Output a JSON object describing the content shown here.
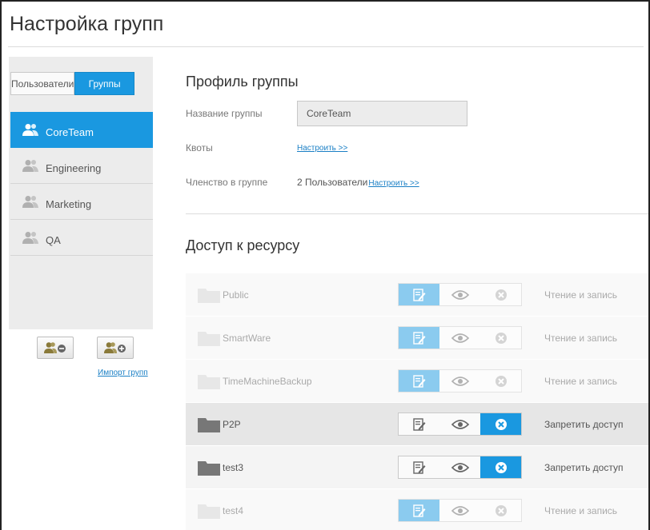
{
  "page": {
    "title": "Настройка групп"
  },
  "sidebar": {
    "tabs": {
      "users": "Пользователи",
      "groups": "Группы"
    },
    "groups": [
      {
        "name": "CoreTeam",
        "active": true
      },
      {
        "name": "Engineering",
        "active": false
      },
      {
        "name": "Marketing",
        "active": false
      },
      {
        "name": "QA",
        "active": false
      }
    ],
    "import_label": "Импорт групп"
  },
  "profile": {
    "title": "Профиль группы",
    "name_label": "Название группы",
    "name_value": "CoreTeam",
    "quota_label": "Квоты",
    "quota_link": "Настроить >>",
    "membership_label": "Членство в группе",
    "membership_count": "2 Пользователи",
    "membership_link": "Настроить >>"
  },
  "access": {
    "title": "Доступ к ресурсу",
    "shares": [
      {
        "name": "Public",
        "status": "Чтение и запись",
        "permission": "read-write",
        "enabled": false
      },
      {
        "name": "SmartWare",
        "status": "Чтение и запись",
        "permission": "read-write",
        "enabled": false
      },
      {
        "name": "TimeMachineBackup",
        "status": "Чтение и запись",
        "permission": "read-write",
        "enabled": false
      },
      {
        "name": "P2P",
        "status": "Запретить доступ",
        "permission": "deny",
        "enabled": true
      },
      {
        "name": "test3",
        "status": "Запретить доступ",
        "permission": "deny",
        "enabled": true
      },
      {
        "name": "test4",
        "status": "Чтение и запись",
        "permission": "read-write",
        "enabled": false
      }
    ]
  },
  "colors": {
    "accent": "#1a98e0",
    "link": "#1a7fc5",
    "panel": "#ececec"
  }
}
